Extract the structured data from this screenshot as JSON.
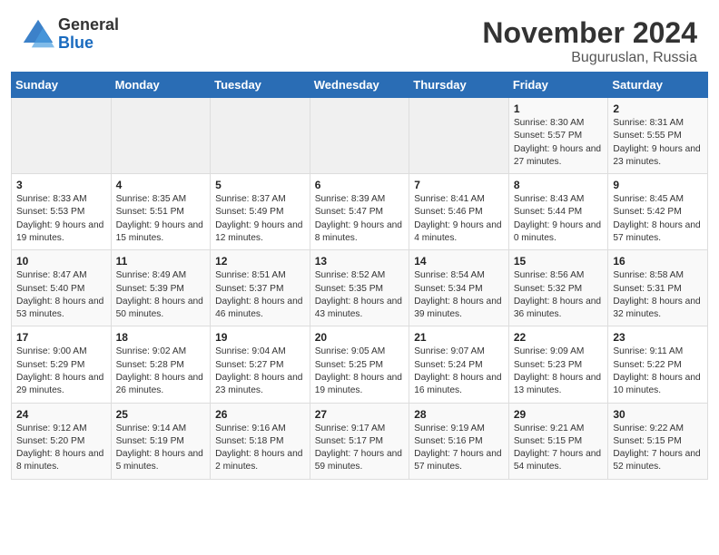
{
  "header": {
    "logo_general": "General",
    "logo_blue": "Blue",
    "month": "November 2024",
    "location": "Buguruslan, Russia"
  },
  "days_of_week": [
    "Sunday",
    "Monday",
    "Tuesday",
    "Wednesday",
    "Thursday",
    "Friday",
    "Saturday"
  ],
  "weeks": [
    [
      {
        "day": "",
        "info": ""
      },
      {
        "day": "",
        "info": ""
      },
      {
        "day": "",
        "info": ""
      },
      {
        "day": "",
        "info": ""
      },
      {
        "day": "",
        "info": ""
      },
      {
        "day": "1",
        "info": "Sunrise: 8:30 AM\nSunset: 5:57 PM\nDaylight: 9 hours and 27 minutes."
      },
      {
        "day": "2",
        "info": "Sunrise: 8:31 AM\nSunset: 5:55 PM\nDaylight: 9 hours and 23 minutes."
      }
    ],
    [
      {
        "day": "3",
        "info": "Sunrise: 8:33 AM\nSunset: 5:53 PM\nDaylight: 9 hours and 19 minutes."
      },
      {
        "day": "4",
        "info": "Sunrise: 8:35 AM\nSunset: 5:51 PM\nDaylight: 9 hours and 15 minutes."
      },
      {
        "day": "5",
        "info": "Sunrise: 8:37 AM\nSunset: 5:49 PM\nDaylight: 9 hours and 12 minutes."
      },
      {
        "day": "6",
        "info": "Sunrise: 8:39 AM\nSunset: 5:47 PM\nDaylight: 9 hours and 8 minutes."
      },
      {
        "day": "7",
        "info": "Sunrise: 8:41 AM\nSunset: 5:46 PM\nDaylight: 9 hours and 4 minutes."
      },
      {
        "day": "8",
        "info": "Sunrise: 8:43 AM\nSunset: 5:44 PM\nDaylight: 9 hours and 0 minutes."
      },
      {
        "day": "9",
        "info": "Sunrise: 8:45 AM\nSunset: 5:42 PM\nDaylight: 8 hours and 57 minutes."
      }
    ],
    [
      {
        "day": "10",
        "info": "Sunrise: 8:47 AM\nSunset: 5:40 PM\nDaylight: 8 hours and 53 minutes."
      },
      {
        "day": "11",
        "info": "Sunrise: 8:49 AM\nSunset: 5:39 PM\nDaylight: 8 hours and 50 minutes."
      },
      {
        "day": "12",
        "info": "Sunrise: 8:51 AM\nSunset: 5:37 PM\nDaylight: 8 hours and 46 minutes."
      },
      {
        "day": "13",
        "info": "Sunrise: 8:52 AM\nSunset: 5:35 PM\nDaylight: 8 hours and 43 minutes."
      },
      {
        "day": "14",
        "info": "Sunrise: 8:54 AM\nSunset: 5:34 PM\nDaylight: 8 hours and 39 minutes."
      },
      {
        "day": "15",
        "info": "Sunrise: 8:56 AM\nSunset: 5:32 PM\nDaylight: 8 hours and 36 minutes."
      },
      {
        "day": "16",
        "info": "Sunrise: 8:58 AM\nSunset: 5:31 PM\nDaylight: 8 hours and 32 minutes."
      }
    ],
    [
      {
        "day": "17",
        "info": "Sunrise: 9:00 AM\nSunset: 5:29 PM\nDaylight: 8 hours and 29 minutes."
      },
      {
        "day": "18",
        "info": "Sunrise: 9:02 AM\nSunset: 5:28 PM\nDaylight: 8 hours and 26 minutes."
      },
      {
        "day": "19",
        "info": "Sunrise: 9:04 AM\nSunset: 5:27 PM\nDaylight: 8 hours and 23 minutes."
      },
      {
        "day": "20",
        "info": "Sunrise: 9:05 AM\nSunset: 5:25 PM\nDaylight: 8 hours and 19 minutes."
      },
      {
        "day": "21",
        "info": "Sunrise: 9:07 AM\nSunset: 5:24 PM\nDaylight: 8 hours and 16 minutes."
      },
      {
        "day": "22",
        "info": "Sunrise: 9:09 AM\nSunset: 5:23 PM\nDaylight: 8 hours and 13 minutes."
      },
      {
        "day": "23",
        "info": "Sunrise: 9:11 AM\nSunset: 5:22 PM\nDaylight: 8 hours and 10 minutes."
      }
    ],
    [
      {
        "day": "24",
        "info": "Sunrise: 9:12 AM\nSunset: 5:20 PM\nDaylight: 8 hours and 8 minutes."
      },
      {
        "day": "25",
        "info": "Sunrise: 9:14 AM\nSunset: 5:19 PM\nDaylight: 8 hours and 5 minutes."
      },
      {
        "day": "26",
        "info": "Sunrise: 9:16 AM\nSunset: 5:18 PM\nDaylight: 8 hours and 2 minutes."
      },
      {
        "day": "27",
        "info": "Sunrise: 9:17 AM\nSunset: 5:17 PM\nDaylight: 7 hours and 59 minutes."
      },
      {
        "day": "28",
        "info": "Sunrise: 9:19 AM\nSunset: 5:16 PM\nDaylight: 7 hours and 57 minutes."
      },
      {
        "day": "29",
        "info": "Sunrise: 9:21 AM\nSunset: 5:15 PM\nDaylight: 7 hours and 54 minutes."
      },
      {
        "day": "30",
        "info": "Sunrise: 9:22 AM\nSunset: 5:15 PM\nDaylight: 7 hours and 52 minutes."
      }
    ]
  ]
}
